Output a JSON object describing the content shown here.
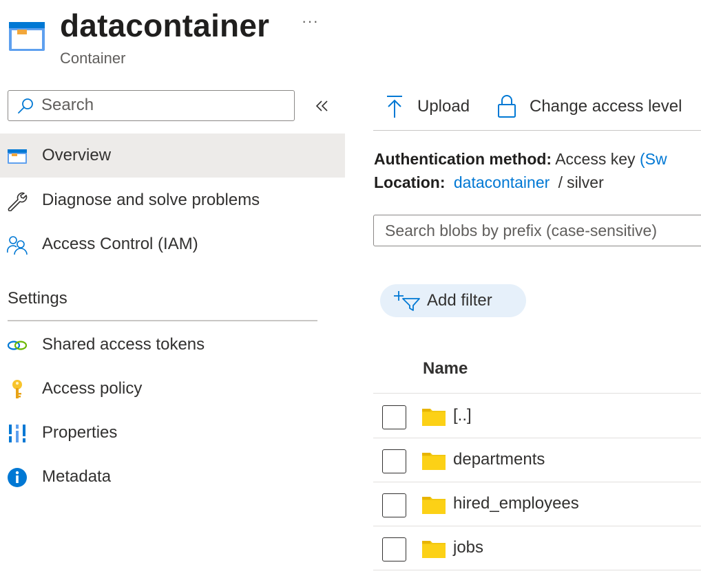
{
  "header": {
    "title": "datacontainer",
    "subtitle": "Container",
    "more_label": "···",
    "icon": "container-icon"
  },
  "search": {
    "placeholder": "Search",
    "value": ""
  },
  "nav": {
    "items": [
      {
        "label": "Overview",
        "icon": "overview-icon",
        "selected": true
      },
      {
        "label": "Diagnose and solve problems",
        "icon": "wrench-icon"
      },
      {
        "label": "Access Control (IAM)",
        "icon": "people-icon"
      }
    ],
    "settings_heading": "Settings",
    "settings_items": [
      {
        "label": "Shared access tokens",
        "icon": "link-icon"
      },
      {
        "label": "Access policy",
        "icon": "key-icon"
      },
      {
        "label": "Properties",
        "icon": "properties-icon"
      },
      {
        "label": "Metadata",
        "icon": "info-icon"
      }
    ]
  },
  "toolbar": {
    "upload_label": "Upload",
    "change_access_label": "Change access level"
  },
  "auth": {
    "label": "Authentication method:",
    "value": "Access key",
    "switch_link": "(Sw"
  },
  "location": {
    "label": "Location:",
    "link": "datacontainer",
    "separator": "/",
    "path": "silver"
  },
  "blob_search": {
    "placeholder": "Search blobs by prefix (case-sensitive)"
  },
  "filter": {
    "add_label": "Add filter"
  },
  "table": {
    "column_name": "Name",
    "rows": [
      {
        "name": "[..]"
      },
      {
        "name": "departments"
      },
      {
        "name": "hired_employees"
      },
      {
        "name": "jobs"
      }
    ]
  },
  "colors": {
    "accent": "#0078d4",
    "selected_bg": "#edebe9",
    "folder": "#f2c811",
    "pill_bg": "#e6f0fa"
  }
}
